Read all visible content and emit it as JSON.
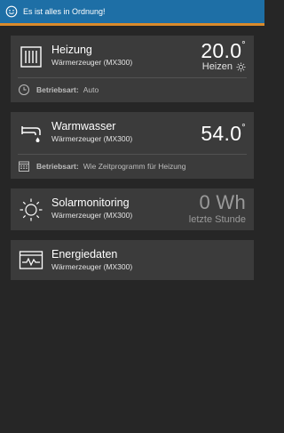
{
  "status": {
    "text": "Es ist alles in Ordnung!",
    "icon": "smiley-icon"
  },
  "cards": {
    "heizung": {
      "title": "Heizung",
      "subtitle": "Wärmerzeuger (MX300)",
      "value": "20.0",
      "unit": "°",
      "mode_label": "Heizen",
      "mode_icon": "sun-icon",
      "detail_label": "Betriebsart:",
      "detail_value": "Auto",
      "detail_icon": "clock-icon",
      "icon": "radiator-icon"
    },
    "warmwasser": {
      "title": "Warmwasser",
      "subtitle": "Wärmerzeuger (MX300)",
      "value": "54.0",
      "unit": "°",
      "detail_label": "Betriebsart:",
      "detail_value": "Wie Zeitprogramm für Heizung",
      "detail_icon": "schedule-icon",
      "icon": "faucet-icon"
    },
    "solar": {
      "title": "Solarmonitoring",
      "subtitle": "Wärmerzeuger (MX300)",
      "value": "0 Wh",
      "value_caption": "letzte Stunde",
      "icon": "sun-icon"
    },
    "energie": {
      "title": "Energiedaten",
      "subtitle": "Wärmerzeuger (MX300)",
      "icon": "monitor-chart-icon"
    }
  },
  "colors": {
    "background": "#262626",
    "card": "#3b3b3b",
    "status_bar": "#1e6fa6",
    "status_accent": "#d98a2b",
    "muted_text": "#9a9a9a"
  }
}
